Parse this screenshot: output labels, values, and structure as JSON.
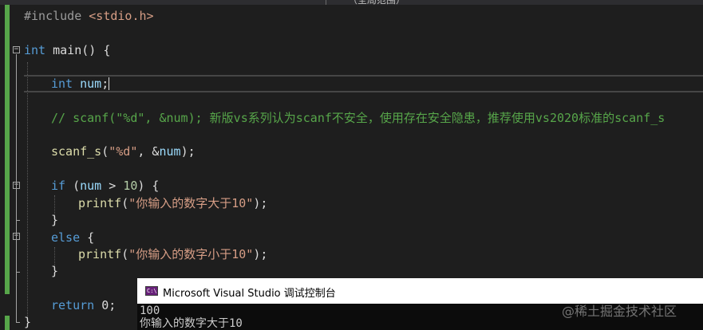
{
  "toolbar": {
    "scope": "（全局范围）"
  },
  "editor": {
    "include_directive": "#include",
    "include_header": "<stdio.h>",
    "main_type": "int",
    "main_decl": " main() {",
    "var_type": "int",
    "var_name": "num",
    "var_end": ";",
    "comment": "// scanf(\"%d\", &num); 新版vs系列认为scanf不安全，使用存在安全隐患，推荐使用vs2020标准的scanf_s",
    "scanf_fn": "scanf_s",
    "scanf_open": "(",
    "scanf_fmt": "\"%d\"",
    "scanf_args": ", &",
    "scanf_var": "num",
    "scanf_close": ");",
    "if_kw": "if",
    "if_open": " (",
    "if_var": "num",
    "if_op": " > ",
    "if_num": "10",
    "if_close": ") {",
    "printf_fn": "printf",
    "printf_open": "(",
    "printf_str_big": "\"你输入的数字大于10\"",
    "printf_close": ");",
    "close_brace": "}",
    "else_kw": "else",
    "else_open": " {",
    "printf_str_small": "\"你输入的数字小于10\"",
    "return_kw": "return",
    "return_val": " 0;",
    "final_brace": "}"
  },
  "console": {
    "title": "Microsoft Visual Studio 调试控制台",
    "icon_label": "C:\\",
    "output_lines": [
      "100",
      "你输入的数字大于10"
    ]
  },
  "watermark": "@稀土掘金技术社区",
  "icons": {
    "fold": "fold-collapse-icon",
    "console_app": "console-app-icon"
  },
  "colors": {
    "background": "#1e1e1e",
    "keyword": "#569cd6",
    "function": "#dcdcaa",
    "string": "#d69d85",
    "comment": "#57a64a",
    "change_bar": "#57a64a"
  }
}
